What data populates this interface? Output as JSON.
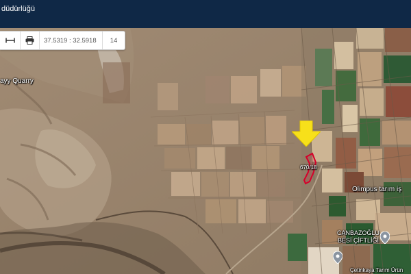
{
  "header": {
    "title": "düdürlüğü",
    "background_color": "#0f2846"
  },
  "toolbar": {
    "measure_icon": "measure-icon",
    "print_icon": "print-icon",
    "coordinates": "37.5319 : 32.5918",
    "zoom_level": "14"
  },
  "map": {
    "type": "satellite",
    "labels": {
      "quarry": "ayy Quarry",
      "parcel": "670/18",
      "olimpus": "Olimpus tarım iş",
      "canbazoglu_line1": "CANBAZOĞLU",
      "canbazoglu_line2": "BESİ ÇİFTLİĞİ",
      "cetinkaya": "Çetinkaya Tarım Ürün"
    },
    "marker_color": "#f7e01a",
    "parcel_outline_color": "#d6002a",
    "pin_icons": [
      "place-pin-icon",
      "place-pin-icon"
    ]
  }
}
